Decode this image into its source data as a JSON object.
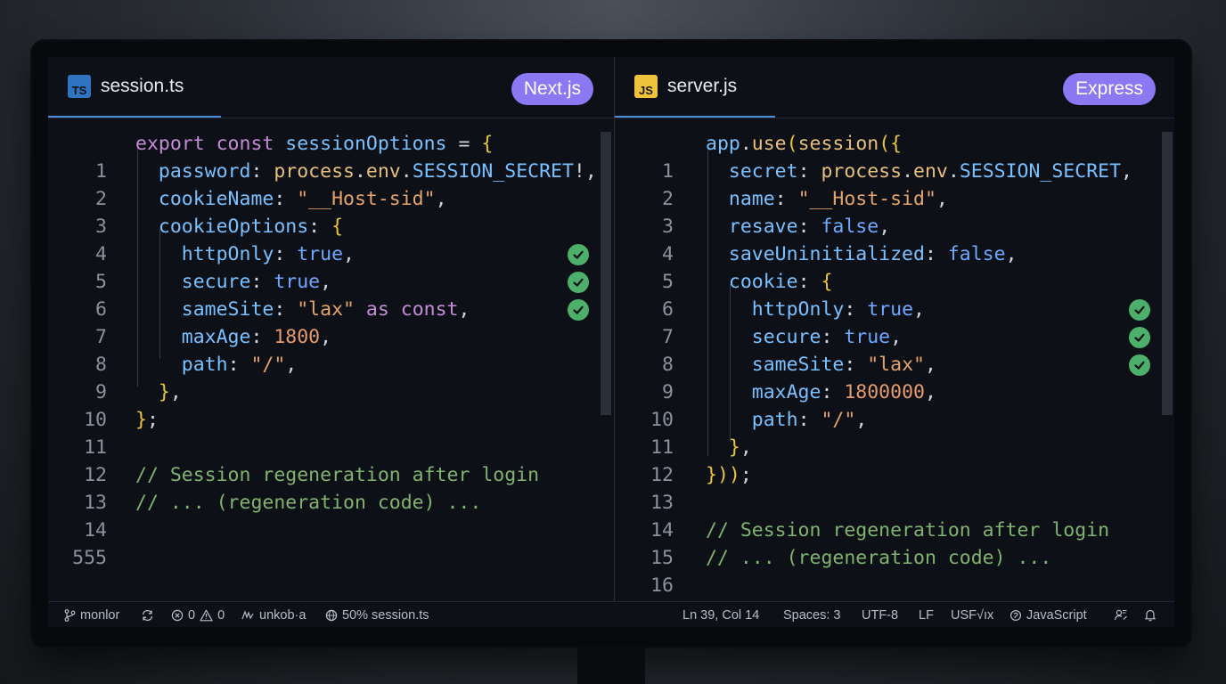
{
  "left": {
    "tab": {
      "icon": "ts-file-icon",
      "icon_text": "TS",
      "name": "session.ts"
    },
    "badge": "Next.js",
    "line_numbers": [
      "1",
      "2",
      "3",
      "4",
      "5",
      "6",
      "7",
      "8",
      "9",
      "10",
      "11",
      "12",
      "13",
      "14",
      "555"
    ],
    "code": {
      "l1": {
        "a": "export",
        "b": " const",
        "c": " sessionOptions",
        "d": " = ",
        "e": "{"
      },
      "l2": {
        "a": "password",
        "b": ": ",
        "c": "process",
        "d": ".",
        "e": "env",
        "f": ".",
        "g": "SESSION_SECRET",
        "h": "!,"
      },
      "l3": {
        "a": "cookieName",
        "b": ": ",
        "c": "\"__Host-sid\"",
        "d": ","
      },
      "l4": {
        "a": "cookieOptions",
        "b": ": ",
        "c": "{"
      },
      "l5": {
        "a": "httpOnly",
        "b": ": ",
        "c": "true",
        "d": ","
      },
      "l6": {
        "a": "secure",
        "b": ": ",
        "c": "true",
        "d": ","
      },
      "l7": {
        "a": "sameSite",
        "b": ": ",
        "c": "\"lax\"",
        "d": " as",
        "e": " const",
        "f": ","
      },
      "l8": {
        "a": "maxAge",
        "b": ": ",
        "c": "1800",
        "d": ","
      },
      "l9": {
        "a": "path",
        "b": ": ",
        "c": "\"/\"",
        "d": ","
      },
      "l10": {
        "a": "}",
        "b": ","
      },
      "l11": {
        "a": "}",
        "b": ";"
      },
      "l13": "// Session regeneration after login",
      "l14": "// ... (regeneration code) ..."
    }
  },
  "right": {
    "tab": {
      "icon": "js-file-icon",
      "icon_text": "JS",
      "name": "server.js"
    },
    "badge": "Express",
    "line_numbers": [
      "1",
      "2",
      "3",
      "4",
      "5",
      "6",
      "7",
      "8",
      "9",
      "10",
      "11",
      "12",
      "13",
      "14",
      "15",
      "16"
    ],
    "code": {
      "l1": {
        "a": "app",
        "b": ".",
        "c": "use",
        "d": "(",
        "e": "session",
        "f": "({"
      },
      "l2": {
        "a": "secret",
        "b": ": ",
        "c": "process",
        "d": ".",
        "e": "env",
        "f": ".",
        "g": "SESSION_SECRET",
        "h": ","
      },
      "l3": {
        "a": "name",
        "b": ": ",
        "c": "\"__Host-sid\"",
        "d": ","
      },
      "l4": {
        "a": "resave",
        "b": ": ",
        "c": "false",
        "d": ","
      },
      "l5": {
        "a": "saveUninitialized",
        "b": ": ",
        "c": "false",
        "d": ","
      },
      "l6": {
        "a": "cookie",
        "b": ": ",
        "c": "{"
      },
      "l7": {
        "a": "httpOnly",
        "b": ": ",
        "c": "true",
        "d": ","
      },
      "l8": {
        "a": "secure",
        "b": ": ",
        "c": "true",
        "d": ","
      },
      "l9": {
        "a": "sameSite",
        "b": ": ",
        "c": "\"lax\"",
        "d": ","
      },
      "l10": {
        "a": "maxAge",
        "b": ": ",
        "c": "1800000",
        "d": ","
      },
      "l11": {
        "a": "path",
        "b": ": ",
        "c": "\"/\"",
        "d": ","
      },
      "l12": {
        "a": "}",
        "b": ","
      },
      "l13": {
        "a": "}",
        "b": "))",
        "c": ";"
      },
      "l15": "// Session regeneration after login",
      "l16": "// ... (regeneration code) ..."
    }
  },
  "statusbar": {
    "branch": "monlor",
    "errors": "0",
    "warnings": "0",
    "account": "unkob·a",
    "progress": "50% session.ts",
    "position": "Ln 39, Col 14",
    "spaces": "Spaces: 3",
    "encoding": "UTF-8",
    "eol": "LF",
    "mode": "USF√ıx",
    "language": "JavaScript"
  },
  "colors": {
    "accent_tab": "#4a90d9",
    "badge": "#8b78f2",
    "check": "#4caf6a"
  }
}
